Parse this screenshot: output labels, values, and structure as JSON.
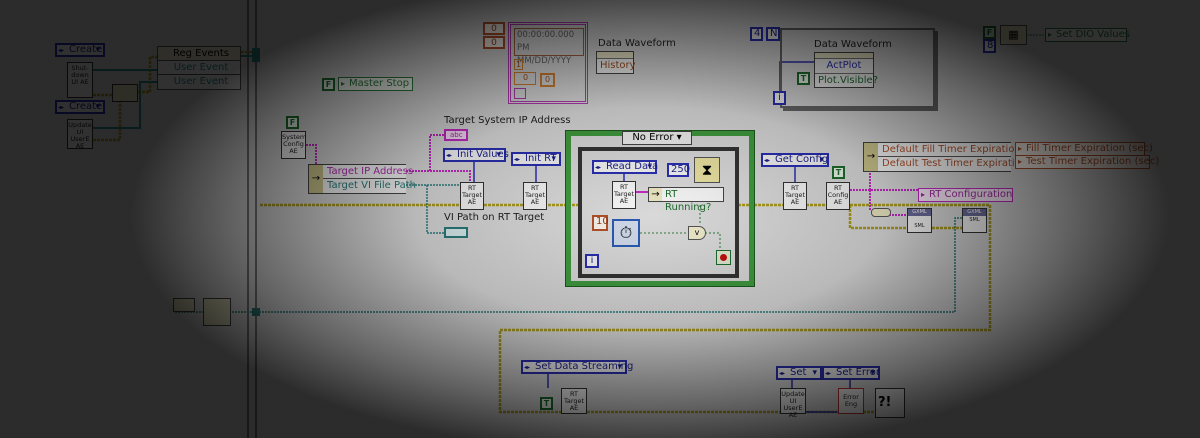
{
  "left": {
    "create_1": "Create",
    "create_2": "Create",
    "shutdown_ae": "Shut-down UI AE",
    "update_ae": "Update UI UserE AE",
    "reg_events": "Reg Events",
    "user_event_1": "User Event",
    "user_event_2": "User Event"
  },
  "master_stop": {
    "const": "F",
    "label": "Master Stop"
  },
  "system_config": {
    "const": "F",
    "node": "System Config AE"
  },
  "unbundle_target": {
    "row1": "Target IP Address",
    "row2": "Target VI File Path"
  },
  "labels": {
    "target_ip": "Target System IP Address",
    "vi_path": "VI Path on RT Target",
    "string_ind": "abc"
  },
  "init": {
    "init_values": "Init Values",
    "init_rt": "Init RT",
    "rt_target_ae": "RT Target AE"
  },
  "case": {
    "selector": "No Error",
    "read_data": "Read Data",
    "wait_ms": "250",
    "rt_running": "RT Running?",
    "timeout": "10",
    "iteration": "i",
    "rt_target_ae": "RT Target AE"
  },
  "waveform_1": {
    "n1": "0",
    "n2": "0",
    "timestamp": "00:00:00.000 PM",
    "date": "MM/DD/YYYY",
    "dt": "1",
    "y_index": "0",
    "y_value": "0",
    "label": "Data Waveform",
    "property": "History"
  },
  "waveform_2": {
    "count": "4",
    "n": "N",
    "label": "Data Waveform",
    "prop_1": "ActPlot",
    "prop_2": "Plot.Visible?",
    "const": "T",
    "iteration": "i"
  },
  "dio": {
    "const_f": "F",
    "const_8": "8",
    "label": "Set DIO Values"
  },
  "config": {
    "get_config": "Get Config",
    "const": "T",
    "rt_target_ae": "RT Target AE",
    "rt_config_ae": "RT Config AE",
    "row1": "Default Fill Timer Expiration",
    "row2": "Default Test Timer Expiration",
    "fill_local": "Fill Timer Expiration (sec)",
    "test_local": "Test Timer Expiration (sec)",
    "rt_configuration": "RT Configuration",
    "xml_1": "GXML",
    "xml_2": "GXML",
    "xml_sub": "SML"
  },
  "bottom": {
    "set_data_streaming": "Set Data Streaming",
    "const": "T",
    "rt_target_ae": "RT Target AE",
    "set": "Set",
    "update_ae": "Update UI UserE AE",
    "set_error": "Set Error",
    "error_eng": "Error Eng"
  },
  "colors": {
    "error_wire": "#b8a800",
    "string_wire": "#c02ac0",
    "path_wire": "#2a7a7a",
    "bool": "#1d6b2d",
    "enum": "#2a2fb0",
    "dbl": "#b0502a",
    "case_border": "#3f9a3f"
  }
}
